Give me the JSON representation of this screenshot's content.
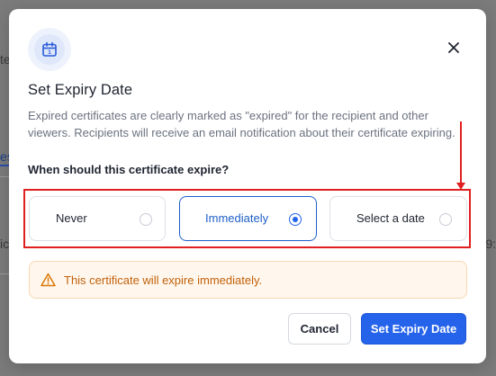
{
  "background": {
    "fragment_1": "te",
    "fragment_2": "es",
    "fragment_3": "ic",
    "fragment_4": "9:"
  },
  "modal": {
    "icon": "calendar-icon",
    "calendar_day": "1",
    "close_icon": "close-icon",
    "title": "Set Expiry Date",
    "description": "Expired certificates are clearly marked as \"expired\" for the recipient and other viewers. Recipients will receive an email notification about their certificate expiring.",
    "question": "When should this certificate expire?",
    "options": [
      {
        "label": "Never",
        "selected": false
      },
      {
        "label": "Immediately",
        "selected": true
      },
      {
        "label": "Select a date",
        "selected": false
      }
    ],
    "alert": {
      "icon": "warning-icon",
      "text": "This certificate will expire immediately."
    },
    "buttons": {
      "cancel": "Cancel",
      "submit": "Set Expiry Date"
    }
  },
  "colors": {
    "accent": "#2563eb",
    "annotation": "#e02020",
    "warning_text": "#c2610c",
    "warning_bg": "#fff7ed"
  }
}
